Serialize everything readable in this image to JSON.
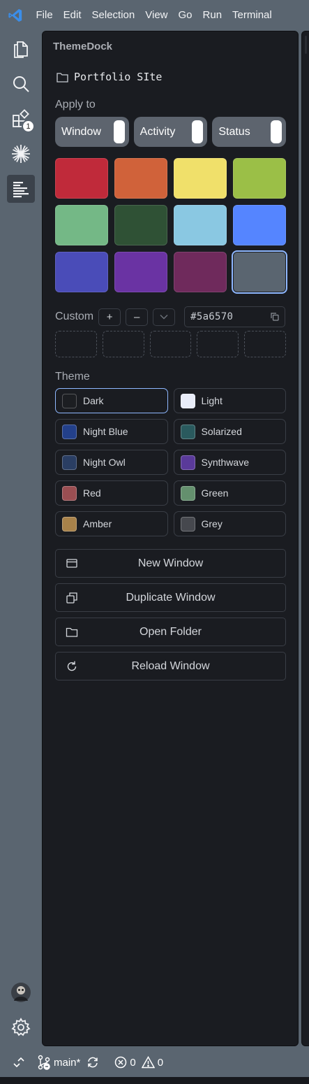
{
  "menu": {
    "items": [
      "File",
      "Edit",
      "Selection",
      "View",
      "Go",
      "Run",
      "Terminal"
    ]
  },
  "activity_bar": {
    "items": [
      {
        "name": "explorer-icon"
      },
      {
        "name": "search-icon"
      },
      {
        "name": "extensions-icon",
        "badge": "1"
      },
      {
        "name": "sparkle-icon"
      },
      {
        "name": "themedock-icon",
        "active": true
      }
    ],
    "bottom": [
      {
        "name": "account-avatar"
      },
      {
        "name": "gear-icon"
      }
    ]
  },
  "panel": {
    "title": "ThemeDock",
    "folder": "Portfolio SIte",
    "apply_to": {
      "label": "Apply to",
      "toggles": [
        "Window",
        "Activity",
        "Status"
      ]
    },
    "swatches": [
      "#c02a3a",
      "#d0623a",
      "#f0e06a",
      "#9bbf47",
      "#74b886",
      "#2f5135",
      "#8ac8e2",
      "#5585ff",
      "#4a4cb8",
      "#6a33a3",
      "#6f2a5c",
      "#5a6570"
    ],
    "selected_swatch": 11,
    "custom": {
      "label": "Custom",
      "plus": "+",
      "minus": "–",
      "hex": "#5a6570",
      "slot_count": 5
    },
    "theme": {
      "label": "Theme",
      "options": [
        {
          "label": "Dark",
          "color": "#1c1e22",
          "selected": true
        },
        {
          "label": "Light",
          "color": "#e8ecf8"
        },
        {
          "label": "Night Blue",
          "color": "#23408a"
        },
        {
          "label": "Solarized",
          "color": "#2a5a5e"
        },
        {
          "label": "Night Owl",
          "color": "#2a3e63"
        },
        {
          "label": "Synthwave",
          "color": "#5a3a9a"
        },
        {
          "label": "Red",
          "color": "#9a4e52"
        },
        {
          "label": "Green",
          "color": "#64906e"
        },
        {
          "label": "Amber",
          "color": "#a8824a"
        },
        {
          "label": "Grey",
          "color": "#46484e"
        }
      ]
    },
    "actions": [
      {
        "label": "New Window",
        "icon": "window-icon"
      },
      {
        "label": "Duplicate Window",
        "icon": "duplicate-icon"
      },
      {
        "label": "Open Folder",
        "icon": "folder-icon"
      },
      {
        "label": "Reload Window",
        "icon": "reload-icon"
      }
    ]
  },
  "status_bar": {
    "branch": "main*",
    "errors": "0",
    "warnings": "0"
  },
  "colors": {
    "accent": "#8fb8ff",
    "panel_bg": "#1a1c21",
    "window_bg": "#5a6570"
  }
}
